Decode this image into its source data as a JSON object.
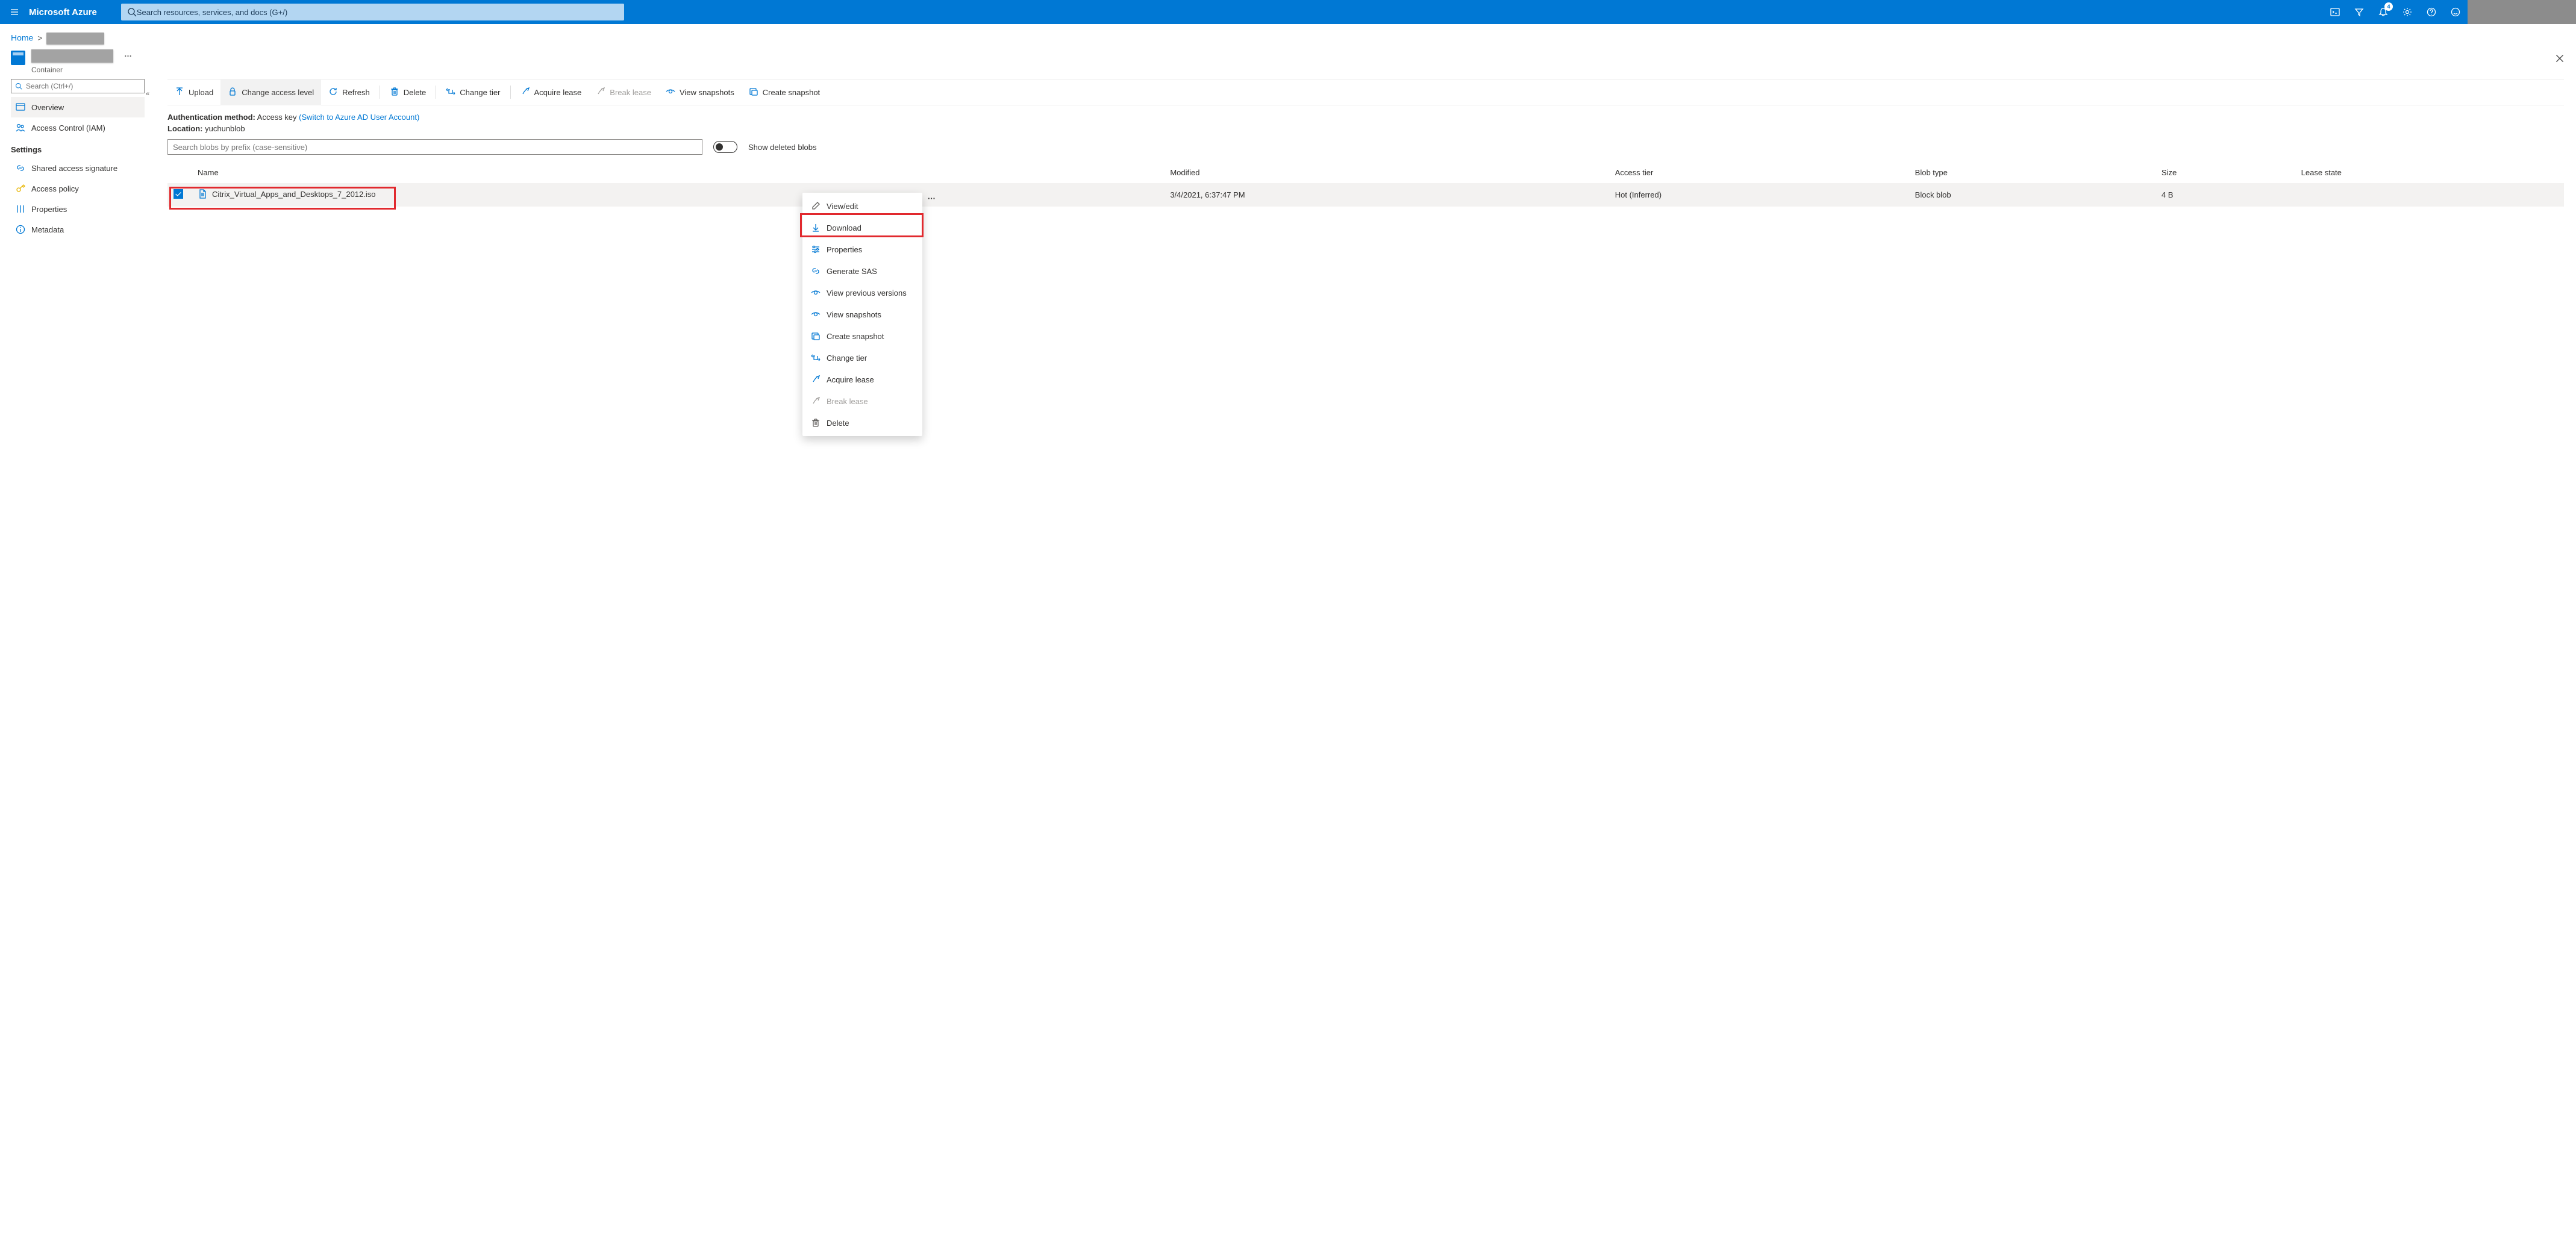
{
  "topbar": {
    "brand": "Microsoft Azure",
    "search_placeholder": "Search resources, services, and docs (G+/)",
    "notification_count": "4"
  },
  "breadcrumb": {
    "home_label": "Home"
  },
  "header": {
    "subtitle": "Container",
    "more": "…"
  },
  "sidebar": {
    "search_placeholder": "Search (Ctrl+/)",
    "collapse": "«",
    "items": [
      {
        "label": "Overview",
        "icon": "overview-icon",
        "selected": true
      },
      {
        "label": "Access Control (IAM)",
        "icon": "people-icon",
        "selected": false
      }
    ],
    "settings_heading": "Settings",
    "settings_items": [
      {
        "label": "Shared access signature",
        "icon": "link-icon"
      },
      {
        "label": "Access policy",
        "icon": "key-icon"
      },
      {
        "label": "Properties",
        "icon": "properties-icon"
      },
      {
        "label": "Metadata",
        "icon": "info-icon"
      }
    ]
  },
  "toolbar": [
    {
      "label": "Upload",
      "icon": "upload-icon"
    },
    {
      "label": "Change access level",
      "icon": "lock-icon"
    },
    {
      "label": "Refresh",
      "icon": "refresh-icon"
    },
    {
      "sep": true
    },
    {
      "label": "Delete",
      "icon": "trash-icon"
    },
    {
      "sep": true
    },
    {
      "label": "Change tier",
      "icon": "tier-icon"
    },
    {
      "sep": true
    },
    {
      "label": "Acquire lease",
      "icon": "lease-icon"
    },
    {
      "label": "Break lease",
      "icon": "break-lease-icon",
      "disabled": true
    },
    {
      "label": "View snapshots",
      "icon": "view-icon"
    },
    {
      "label": "Create snapshot",
      "icon": "snapshot-icon"
    }
  ],
  "meta": {
    "auth_label": "Authentication method:",
    "auth_value": "Access key",
    "auth_link": "(Switch to Azure AD User Account)",
    "location_label": "Location:",
    "location_value": "yuchunblob"
  },
  "blob_search_placeholder": "Search blobs by prefix (case-sensitive)",
  "show_deleted_label": "Show deleted blobs",
  "table": {
    "headers": [
      "Name",
      "Modified",
      "Access tier",
      "Blob type",
      "Size",
      "Lease state"
    ],
    "rows": [
      {
        "checked": true,
        "name": "Citrix_Virtual_Apps_and_Desktops_7_2012.iso",
        "modified": "3/4/2021, 6:37:47 PM",
        "access_tier": "Hot (Inferred)",
        "blob_type": "Block blob",
        "size": "4 B",
        "lease_state": ""
      }
    ]
  },
  "context_menu": [
    {
      "label": "View/edit",
      "icon": "pencil-icon",
      "accent": false
    },
    {
      "label": "Download",
      "icon": "download-icon"
    },
    {
      "label": "Properties",
      "icon": "sliders-icon"
    },
    {
      "label": "Generate SAS",
      "icon": "link2-icon"
    },
    {
      "label": "View previous versions",
      "icon": "view-icon"
    },
    {
      "label": "View snapshots",
      "icon": "view-icon"
    },
    {
      "label": "Create snapshot",
      "icon": "snapshot-icon"
    },
    {
      "label": "Change tier",
      "icon": "tier-icon"
    },
    {
      "label": "Acquire lease",
      "icon": "lease-icon"
    },
    {
      "label": "Break lease",
      "icon": "break-lease-icon",
      "disabled": true
    },
    {
      "label": "Delete",
      "icon": "trash-icon",
      "accent": false
    }
  ]
}
